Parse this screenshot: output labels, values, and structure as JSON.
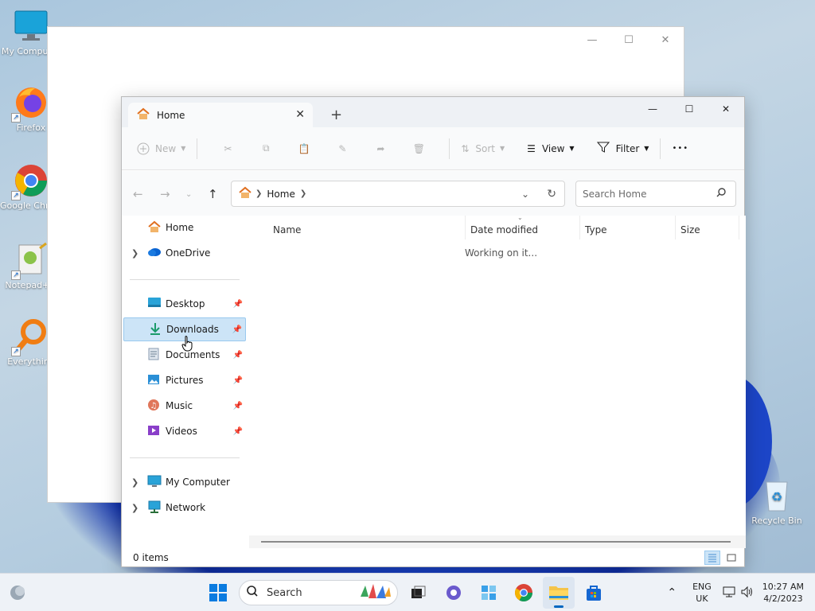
{
  "desktop": {
    "icons": [
      {
        "label": "My Computer"
      },
      {
        "label": "Firefox"
      },
      {
        "label": "Google Chrome"
      },
      {
        "label": "Notepad++"
      },
      {
        "label": "Everything"
      },
      {
        "label": "Recycle Bin"
      }
    ]
  },
  "explorer": {
    "tab": {
      "label": "Home"
    },
    "toolbar": {
      "new_label": "New",
      "sort_label": "Sort",
      "view_label": "View",
      "filter_label": "Filter",
      "more_label": "•••"
    },
    "address": {
      "crumb": "Home"
    },
    "search": {
      "placeholder": "Search Home"
    },
    "sidebar": {
      "items": [
        {
          "label": "Home"
        },
        {
          "label": "OneDrive"
        },
        {
          "label": "Desktop"
        },
        {
          "label": "Downloads"
        },
        {
          "label": "Documents"
        },
        {
          "label": "Pictures"
        },
        {
          "label": "Music"
        },
        {
          "label": "Videos"
        },
        {
          "label": "My Computer"
        },
        {
          "label": "Network"
        }
      ]
    },
    "columns": [
      "Name",
      "Date modified",
      "Type",
      "Size"
    ],
    "loading_text": "Working on it...",
    "status": {
      "item_count": "0 items"
    }
  },
  "taskbar": {
    "search_label": "Search",
    "tray": {
      "lang_top": "ENG",
      "lang_bottom": "UK",
      "time": "10:27 AM",
      "date": "4/2/2023"
    }
  },
  "colors": {
    "accent": "#0067c0",
    "selection": "#cce4f7",
    "wallpaper_blue": "#1f4cd8"
  }
}
